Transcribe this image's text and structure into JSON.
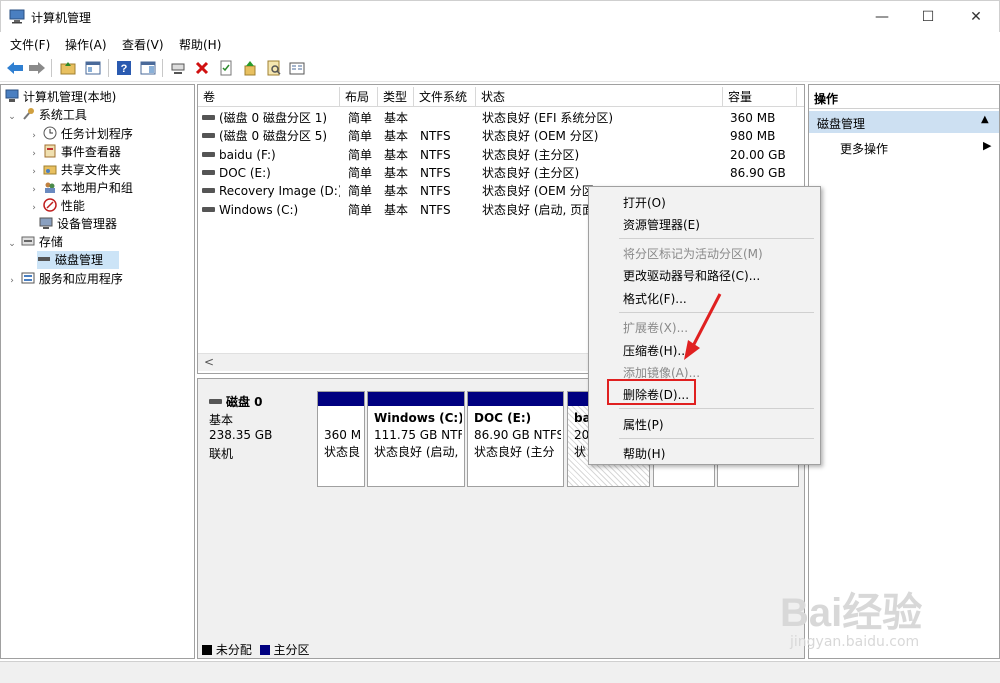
{
  "window": {
    "title": "计算机管理",
    "minimize": "—",
    "maximize": "☐",
    "close": "✕"
  },
  "menu": [
    "文件(F)",
    "操作(A)",
    "查看(V)",
    "帮助(H)"
  ],
  "tree": {
    "root": "计算机管理(本地)",
    "system_tools": "系统工具",
    "task_scheduler": "任务计划程序",
    "event_viewer": "事件查看器",
    "shared_folders": "共享文件夹",
    "local_users": "本地用户和组",
    "performance": "性能",
    "device_manager": "设备管理器",
    "storage": "存储",
    "disk_management": "磁盘管理",
    "services": "服务和应用程序"
  },
  "list": {
    "columns": [
      "卷",
      "布局",
      "类型",
      "文件系统",
      "状态",
      "容量"
    ],
    "rows": [
      {
        "vol": "(磁盘 0 磁盘分区 1)",
        "layout": "简单",
        "type": "基本",
        "fs": "",
        "status": "状态良好 (EFI 系统分区)",
        "cap": "360 MB"
      },
      {
        "vol": "(磁盘 0 磁盘分区 5)",
        "layout": "简单",
        "type": "基本",
        "fs": "NTFS",
        "status": "状态良好 (OEM 分区)",
        "cap": "980 MB"
      },
      {
        "vol": "baidu (F:)",
        "layout": "简单",
        "type": "基本",
        "fs": "NTFS",
        "status": "状态良好 (主分区)",
        "cap": "20.00 GB"
      },
      {
        "vol": "DOC (E:)",
        "layout": "简单",
        "type": "基本",
        "fs": "NTFS",
        "status": "状态良好 (主分区)",
        "cap": "86.90 GB"
      },
      {
        "vol": "Recovery Image (D:)",
        "layout": "简单",
        "type": "基本",
        "fs": "NTFS",
        "status": "状态良好 (OEM 分区",
        "cap": ""
      },
      {
        "vol": "Windows (C:)",
        "layout": "简单",
        "type": "基本",
        "fs": "NTFS",
        "status": "状态良好 (启动, 页面",
        "cap": ""
      }
    ],
    "scroll_left": "<"
  },
  "disk": {
    "name": "磁盘 0",
    "kind": "基本",
    "size": "238.35 GB",
    "state": "联机",
    "partitions": [
      {
        "line1": "",
        "line2": "360 M",
        "line3": "状态良"
      },
      {
        "line1": "Windows (C:)",
        "line2": "111.75 GB NTF",
        "line3": "状态良好 (启动,"
      },
      {
        "line1": "DOC (E:)",
        "line2": "86.90 GB NTFS",
        "line3": "状态良好 (主分"
      },
      {
        "line1": "ba",
        "line2": "20",
        "line3": "状"
      }
    ],
    "legend_unalloc": "未分配",
    "legend_primary": "主分区"
  },
  "actions": {
    "header": "操作",
    "section": "磁盘管理",
    "more": "更多操作"
  },
  "context_menu": {
    "open": "打开(O)",
    "explorer": "资源管理器(E)",
    "mark_active": "将分区标记为活动分区(M)",
    "change_letter": "更改驱动器号和路径(C)...",
    "format": "格式化(F)...",
    "extend": "扩展卷(X)...",
    "shrink": "压缩卷(H)...",
    "mirror": "添加镜像(A)...",
    "delete": "删除卷(D)...",
    "properties": "属性(P)",
    "help": "帮助(H)"
  },
  "colors": {
    "primary_partition": "#000080",
    "highlight_box": "#e02020",
    "arrow": "#e02020",
    "action_header_bg": "#cde0f2"
  },
  "watermark": {
    "brand": "Bai经验",
    "url": "jingyan.baidu.com"
  }
}
